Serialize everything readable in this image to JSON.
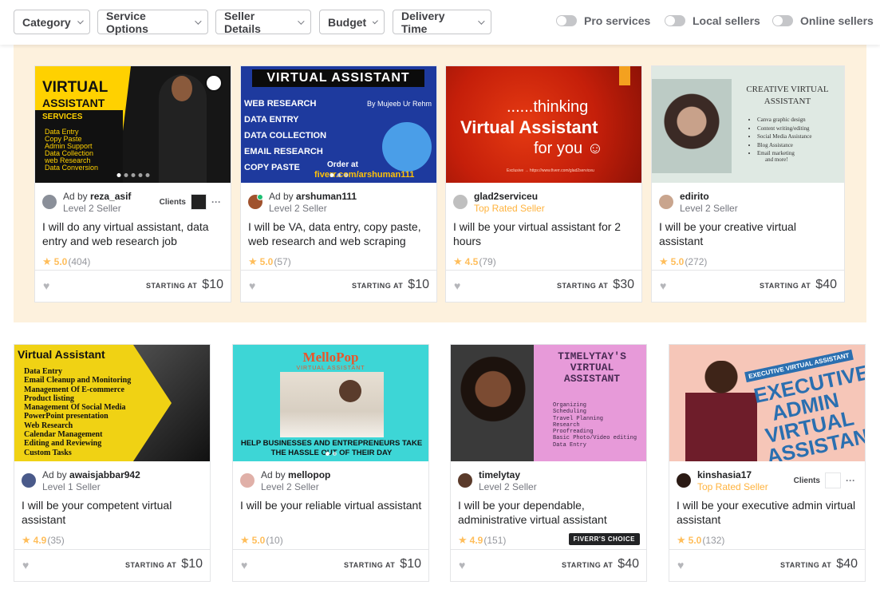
{
  "filters": {
    "buttons": [
      "Category",
      "Service Options",
      "Seller Details",
      "Budget",
      "Delivery Time"
    ],
    "toggles": [
      "Pro services",
      "Local sellers",
      "Online sellers"
    ]
  },
  "labels": {
    "starting_at": "STARTING AT",
    "ad_by": "Ad by",
    "clients": "Clients",
    "fiverrs_choice": "FIVERR'S CHOICE"
  },
  "gigs": [
    {
      "seller": "reza_asif",
      "ad": true,
      "level": "Level 2 Seller",
      "top": false,
      "title": "I will do any virtual assistant, data entry and web research job",
      "score": "5.0",
      "count": "(404)",
      "price": "$10",
      "clients": true,
      "thumb": {
        "h1": "VIRTUAL",
        "h2": "ASSISTANT",
        "services": "SERVICES",
        "list": [
          "Data Entry",
          "Copy Paste",
          "Admin Support",
          "Data Collection",
          "web Research",
          "Data Conversion"
        ]
      }
    },
    {
      "seller": "arshuman111",
      "ad": true,
      "level": "Level 2 Seller",
      "top": false,
      "online": true,
      "title": "I will be VA, data entry, copy paste, web research and web scraping",
      "score": "5.0",
      "count": "(57)",
      "price": "$10",
      "thumb": {
        "band": "VIRTUAL ASSISTANT",
        "by": "By Mujeeb Ur Rehm",
        "list": [
          "WEB RESEARCH",
          "DATA ENTRY",
          "DATA COLLECTION",
          "EMAIL RESEARCH",
          "COPY PASTE"
        ],
        "order": "Order at",
        "url": "fiverr.com/arshuman111"
      }
    },
    {
      "seller": "glad2serviceu",
      "ad": false,
      "level": "Top Rated Seller",
      "top": true,
      "title": "I will be your virtual assistant for 2 hours",
      "score": "4.5",
      "count": "(79)",
      "price": "$30",
      "thumb": {
        "a": "......thinking",
        "b": "Virtual Assistant",
        "c": "for you ☺",
        "foot": "Exclusive → https://www.fiverr.com/glad2serviceu"
      }
    },
    {
      "seller": "edirito",
      "ad": false,
      "level": "Level 2 Seller",
      "top": false,
      "title": "I will be your creative virtual assistant",
      "score": "5.0",
      "count": "(272)",
      "price": "$40",
      "thumb": {
        "hd": "CREATIVE VIRTUAL ASSISTANT",
        "list": [
          "Canva graphic design",
          "Content writing/editing",
          "Social Media Assistance",
          "Blog Assistance",
          "Email marketing"
        ],
        "more": "and more!"
      }
    },
    {
      "seller": "awaisjabbar942",
      "ad": true,
      "level": "Level 1 Seller",
      "top": false,
      "title": "I will be your competent virtual assistant",
      "score": "4.9",
      "count": "(35)",
      "price": "$10",
      "thumb": {
        "h": "Virtual Assistant",
        "list": [
          "Data Entry",
          "Email Cleanup and Monitoring",
          "Management Of E-commerce",
          "Product listing",
          "Management Of Social Media",
          "PowerPoint presentation",
          "Web Research",
          "Calendar Management",
          "Editing and Reviewing",
          "Custom Tasks"
        ]
      }
    },
    {
      "seller": "mellopop",
      "ad": true,
      "level": "Level 2 Seller",
      "top": false,
      "title": "I will be your reliable virtual assistant",
      "score": "5.0",
      "count": "(10)",
      "price": "$10",
      "thumb": {
        "logo": "MelloPop",
        "sub": "VIRTUAL ASSISTANT",
        "cap": "HELP  BUSINESSES AND ENTREPRENEURS TAKE THE HASSLE OUT OF THEIR DAY"
      }
    },
    {
      "seller": "timelytay",
      "ad": false,
      "level": "Level 2 Seller",
      "top": false,
      "title": "I will be your dependable, administrative virtual assistant",
      "score": "4.9",
      "count": "(151)",
      "price": "$40",
      "choice": true,
      "thumb": {
        "h": "TIMELYTAY'S VIRTUAL ASSISTANT",
        "list": [
          "Organizing",
          "Scheduling",
          "Travel Planning",
          "Research",
          "Proofreading",
          "Basic Photo/Video editing",
          "Data Entry"
        ]
      }
    },
    {
      "seller": "kinshasia17",
      "ad": false,
      "level": "Top Rated Seller",
      "top": true,
      "title": "I will be your executive admin virtual assistant",
      "score": "5.0",
      "count": "(132)",
      "price": "$40",
      "clients": true,
      "thumb": {
        "badge": "EXECUTIVE VIRTUAL ASSISTANT",
        "big": "EXECUTIVE ADMIN VIRTUAL ASSISTANT"
      }
    }
  ]
}
